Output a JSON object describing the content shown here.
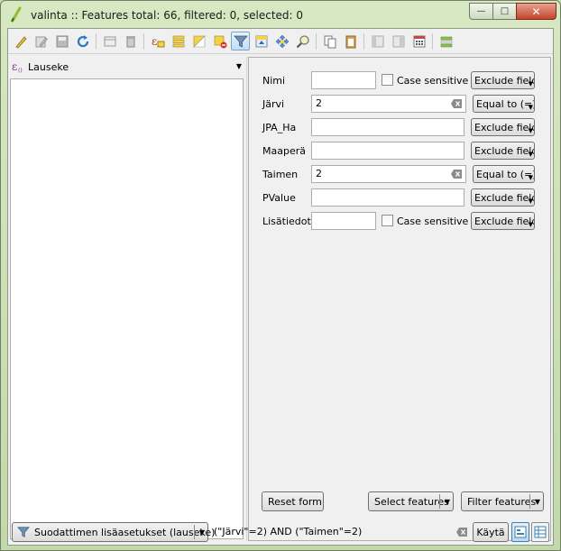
{
  "window": {
    "title": "valinta :: Features total: 66, filtered: 0, selected: 0"
  },
  "toolbar": {
    "icons": [
      "pencil-icon",
      "edit-icon",
      "save-icon",
      "refresh-icon",
      "delete-field-icon",
      "trash-icon",
      "expression-select-icon",
      "select-all-icon",
      "invert-selection-icon",
      "deselect-icon",
      "filter-icon",
      "move-top-icon",
      "pan-icon",
      "zoom-icon",
      "copy-icon",
      "paste-icon",
      "new-field-icon",
      "delete-column-icon",
      "field-calculator-icon",
      "conditional-format-icon"
    ]
  },
  "left": {
    "combo_label": "Lauseke"
  },
  "form": {
    "fields": [
      {
        "label": "Nimi",
        "value": "",
        "case_sensitive": "Case sensitive",
        "operator": "Exclude field"
      },
      {
        "label": "Järvi",
        "value": "2",
        "operator": "Equal to (=)"
      },
      {
        "label": "JPA_Ha",
        "value": "",
        "operator": "Exclude field"
      },
      {
        "label": "Maaperä",
        "value": "",
        "operator": "Exclude field"
      },
      {
        "label": "Taimen",
        "value": "2",
        "operator": "Equal to (=)"
      },
      {
        "label": "PValue",
        "value": "",
        "operator": "Exclude field"
      },
      {
        "label": "Lisätiedot",
        "value": "",
        "case_sensitive": "Case sensitive",
        "operator": "Exclude field"
      }
    ],
    "reset_label": "Reset form",
    "select_label": "Select features",
    "filter_label": "Filter features"
  },
  "bottom": {
    "advanced_filter_label": "Suodattimen lisäasetukset (lauseke)",
    "expression": "(\"Järvi\"=2) AND (\"Taimen\"=2)",
    "apply_label": "Käytä"
  }
}
